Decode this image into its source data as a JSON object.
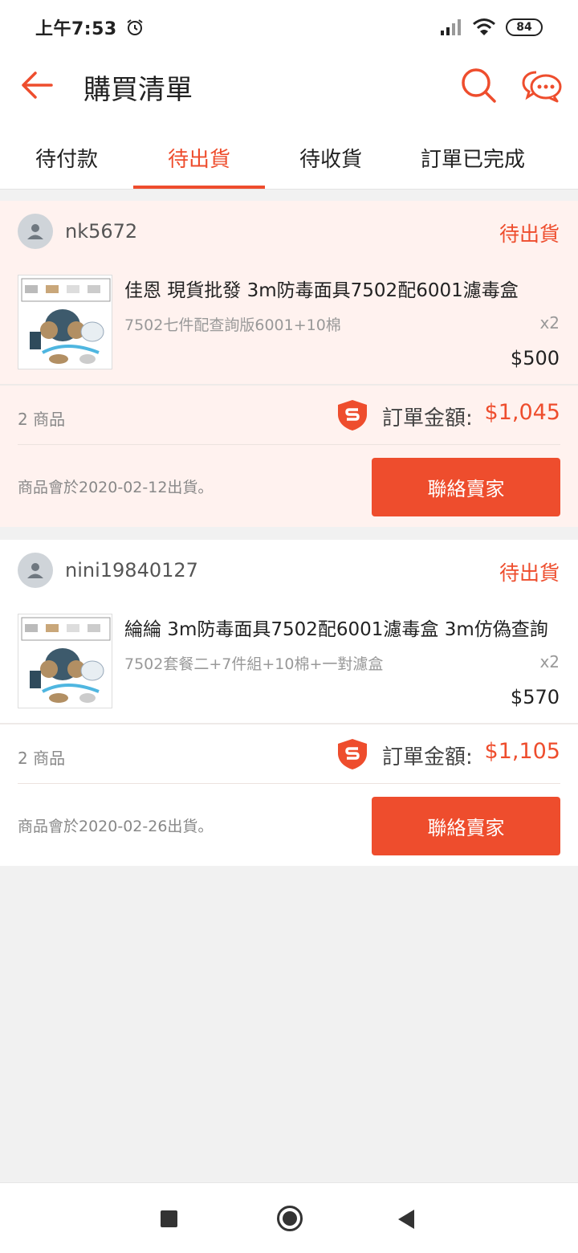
{
  "statusbar": {
    "time": "上午7:53",
    "battery": "84"
  },
  "header": {
    "title": "購買清單"
  },
  "tabs": [
    {
      "label": "待付款"
    },
    {
      "label": "待出貨"
    },
    {
      "label": "待收貨"
    },
    {
      "label": "訂單已完成"
    }
  ],
  "active_tab": "待出貨",
  "orders": [
    {
      "shop": "nk5672",
      "status": "待出貨",
      "product_name": "佳恩 現貨批發 3m防毒面具7502配6001濾毒盒",
      "variant": "7502七件配查詢版6001+10棉",
      "qty": "x2",
      "price": "$500",
      "item_count": "2 商品",
      "total_label": "訂單金額:",
      "total": "$1,045",
      "ship_note": "商品會於2020-02-12出貨。",
      "button": "聯絡賣家"
    },
    {
      "shop": "nini19840127",
      "status": "待出貨",
      "product_name": "綸綸 3m防毒面具7502配6001濾毒盒 3m仿偽查詢",
      "variant": "7502套餐二+7件組+10棉+一對濾盒",
      "qty": "x2",
      "price": "$570",
      "item_count": "2 商品",
      "total_label": "訂單金額:",
      "total": "$1,105",
      "ship_note": "商品會於2020-02-26出貨。",
      "button": "聯絡賣家"
    }
  ],
  "colors": {
    "accent": "#ee4d2d",
    "highlight_bg": "#fff2ef"
  },
  "icons": [
    "alarm-icon",
    "signal-icon",
    "wifi-icon",
    "back-arrow-icon",
    "search-icon",
    "chat-icon",
    "user-icon",
    "shield-icon",
    "nav-recents-icon",
    "nav-home-icon",
    "nav-back-icon"
  ]
}
